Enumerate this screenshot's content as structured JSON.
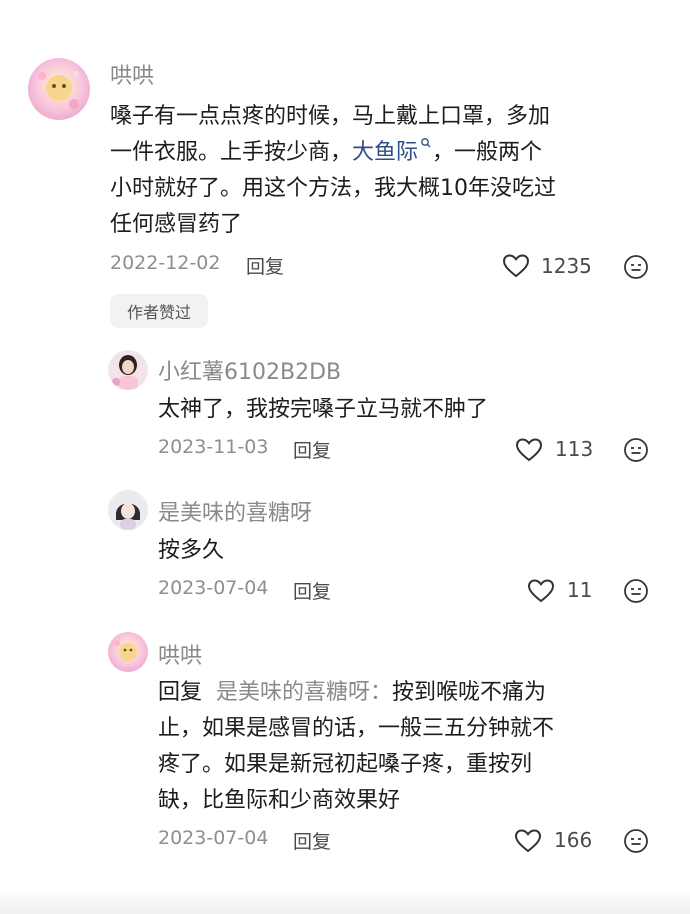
{
  "comments": [
    {
      "username": "哄哄",
      "text_line1": "嗓子有一点点疼的时候，马上戴上口罩，多加",
      "text_line2_before": "一件衣服。上手按少商，",
      "text_line2_link": "大鱼际",
      "text_line2_after": "，一般两个",
      "text_line3": "小时就好了。用这个方法，我大概10年没吃过",
      "text_line4": "任何感冒药了",
      "date": "2022-12-02",
      "reply_label": "回复",
      "likes": "1235",
      "badge": "作者赞过"
    }
  ],
  "replies": [
    {
      "username": "小红薯6102B2DB",
      "text": "太神了，我按完嗓子立马就不肿了",
      "date": "2023-11-03",
      "reply_label": "回复",
      "likes": "113"
    },
    {
      "username": "是美味的喜糖呀",
      "text": "按多久",
      "date": "2023-07-04",
      "reply_label": "回复",
      "likes": "11"
    },
    {
      "username": "哄哄",
      "reply_prefix": "回复",
      "reply_to": "是美味的喜糖呀：",
      "text_line1_after": "按到喉咙不痛为",
      "text_line2": "止，如果是感冒的话，一般三五分钟就不",
      "text_line3": "疼了。如果是新冠初起嗓子疼，重按列",
      "text_line4": "缺，比鱼际和少商效果好",
      "date": "2023-07-04",
      "reply_label": "回复",
      "likes": "166"
    }
  ],
  "icons": {
    "like": "heart-outline-icon",
    "emoji": "emoji-face-icon",
    "search": "search-icon"
  },
  "colors": {
    "link": "#2f4f86",
    "muted": "#8a8a8a",
    "text": "#1d1d1d"
  }
}
